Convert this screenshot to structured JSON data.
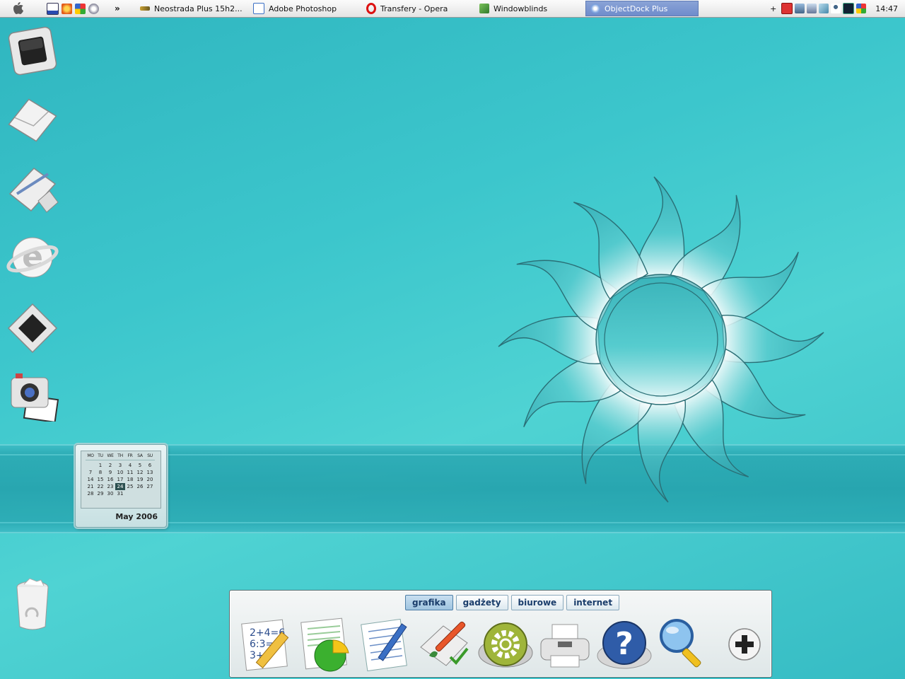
{
  "taskbar": {
    "quicklaunch": [
      "explorer-icon",
      "browser-icon",
      "windows-flag-icon",
      "media-player-icon"
    ],
    "overflow": "»",
    "tasks": [
      {
        "label": "Neostrada Plus 15h2...",
        "icon": "connection-icon",
        "active": false
      },
      {
        "label": "Adobe Photoshop",
        "icon": "photoshop-icon",
        "active": false
      },
      {
        "label": "Transfery - Opera",
        "icon": "opera-icon",
        "active": false
      },
      {
        "label": "Windowblinds",
        "icon": "windowblinds-icon",
        "active": false
      },
      {
        "label": "ObjectDock Plus",
        "icon": "objectdock-icon",
        "active": true
      }
    ],
    "tray_plus": "+",
    "clock": "14:47"
  },
  "calendar": {
    "weekdays": [
      "MO",
      "TU",
      "WE",
      "TH",
      "FR",
      "SA",
      "SU"
    ],
    "days": [
      "",
      "1",
      "2",
      "3",
      "4",
      "5",
      "6",
      "7",
      "8",
      "9",
      "10",
      "11",
      "12",
      "13",
      "14",
      "15",
      "16",
      "17",
      "18",
      "19",
      "20",
      "21",
      "22",
      "23",
      "24",
      "25",
      "26",
      "27",
      "28",
      "29",
      "30",
      "31"
    ],
    "today": "24",
    "caption": "May  2006"
  },
  "dock": {
    "tabs": [
      "grafika",
      "gadżety",
      "biurowe",
      "internet"
    ],
    "selected_tab": "grafika",
    "items": [
      "math-icon",
      "spreadsheet-chart-icon",
      "notepad-icon",
      "paint-icon",
      "settings-icon",
      "printer-icon",
      "help-icon",
      "search-icon",
      "add-icon"
    ]
  },
  "desktop": {
    "icons": [
      "ipod-icon",
      "mail-icon",
      "writing-icon",
      "internet-explorer-icon",
      "ipod-icon",
      "camera-icon",
      "recycle-bin-icon"
    ],
    "accent": "#3cc6cc"
  }
}
